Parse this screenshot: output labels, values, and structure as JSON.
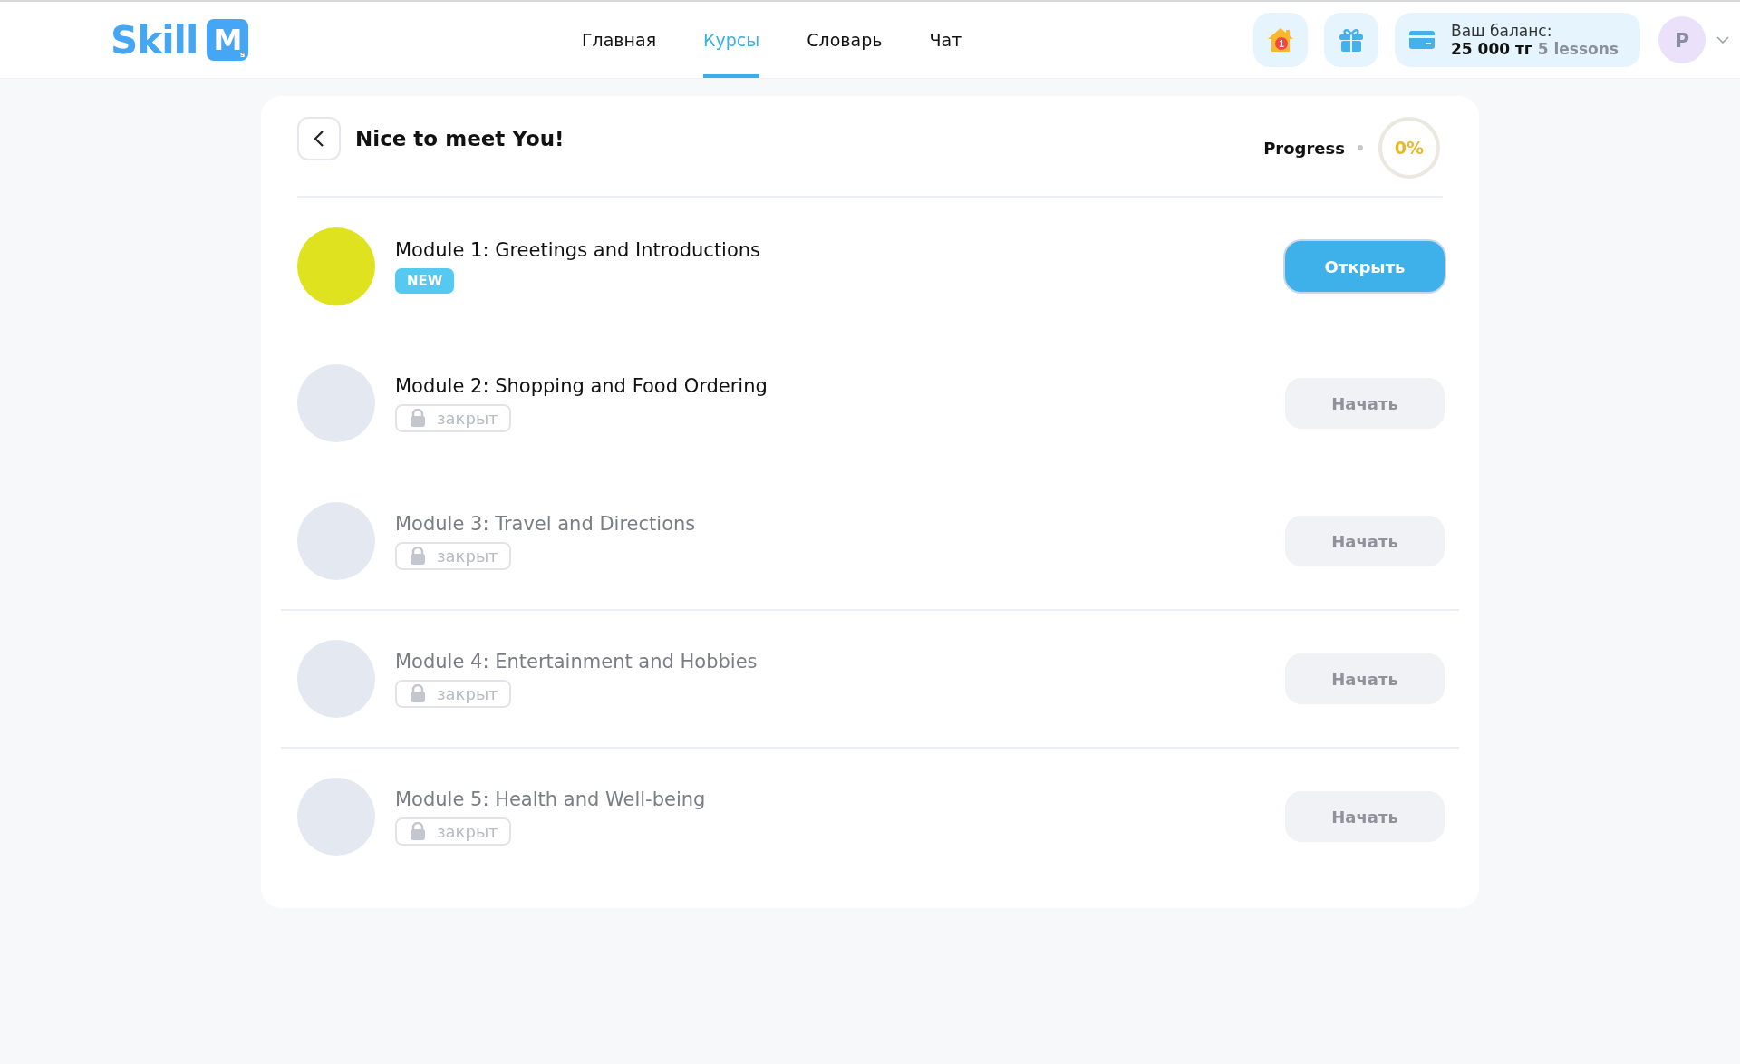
{
  "logo": {
    "text": "Skill",
    "mark": "M",
    "mark_sub": "s"
  },
  "nav": [
    {
      "label": "Главная",
      "selected": false
    },
    {
      "label": "Курсы",
      "selected": true
    },
    {
      "label": "Словарь",
      "selected": false
    },
    {
      "label": "Чат",
      "selected": false
    }
  ],
  "notifications": {
    "count": "1"
  },
  "balance": {
    "label": "Ваш баланс:",
    "amount": "25 000 тг",
    "lessons": "5 lessons"
  },
  "avatar": {
    "initial": "P"
  },
  "course": {
    "title": "Nice to meet You!",
    "progress_label": "Progress",
    "progress_value": "0%",
    "level": 0
  },
  "modules": [
    {
      "title": "Module 1: Greetings and Introductions",
      "color": "#dfe21f",
      "badge": {
        "kind": "new",
        "text": "NEW"
      },
      "dimmed": false,
      "separated": false,
      "button": {
        "label": "Открыть",
        "disabled": false
      }
    },
    {
      "title": "Module 2: Shopping and Food Ordering",
      "color": "#e4e8f1",
      "badge": {
        "kind": "locked",
        "text": "закрыт"
      },
      "dimmed": false,
      "separated": false,
      "button": {
        "label": "Начать",
        "disabled": true
      }
    },
    {
      "title": "Module 3: Travel and Directions",
      "color": "#e4e8f1",
      "badge": {
        "kind": "locked",
        "text": "закрыт"
      },
      "dimmed": true,
      "separated": false,
      "button": {
        "label": "Начать",
        "disabled": true
      }
    },
    {
      "title": "Module 4: Entertainment and Hobbies",
      "color": "#e4e8f1",
      "badge": {
        "kind": "locked",
        "text": "закрыт"
      },
      "dimmed": true,
      "separated": true,
      "button": {
        "label": "Начать",
        "disabled": true
      }
    },
    {
      "title": "Module 5: Health and Well-being",
      "color": "#e4e8f1",
      "badge": {
        "kind": "locked",
        "text": "закрыт"
      },
      "dimmed": true,
      "separated": true,
      "button": {
        "label": "Начать",
        "disabled": true
      }
    }
  ]
}
